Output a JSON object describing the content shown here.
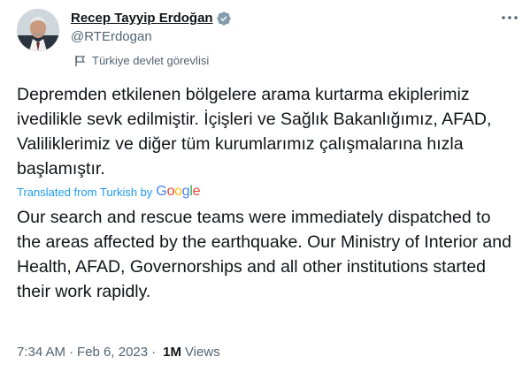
{
  "author": {
    "display_name": "Recep Tayyip Erdoğan",
    "handle": "@RTErdogan",
    "label": "Türkiye devlet görevlisi",
    "verified_color": "#829aab"
  },
  "tweet": {
    "original_text": "Depremden etkilenen bölgelere arama kurtarma ekiplerimiz ivedilikle sevk edilmiştir. İçişleri ve Sağlık Bakanlığımız, AFAD, Valiliklerimiz ve diğer tüm kurumlarımız çalışmalarına hızla başlamıştır.",
    "translated_by_label": "Translated from Turkish by",
    "translator_logo": {
      "g1": "G",
      "o1": "o",
      "o2": "o",
      "g2": "g",
      "l": "l",
      "e": "e"
    },
    "translated_text": "Our search and rescue teams were immediately dispatched to the areas affected by the earthquake. Our Ministry of Interior and Health, AFAD, Governorships and all other institutions started their work rapidly.",
    "time": "7:34 AM",
    "date": "Feb 6, 2023",
    "separator": "·",
    "views_count": "1M",
    "views_label": "Views"
  },
  "icons": {
    "verified": "verified-badge-icon",
    "flag": "flag-icon",
    "more": "more-options-icon"
  },
  "colors": {
    "link_blue": "#1d9bf0",
    "secondary_text": "#536471",
    "primary_text": "#0f1419"
  }
}
